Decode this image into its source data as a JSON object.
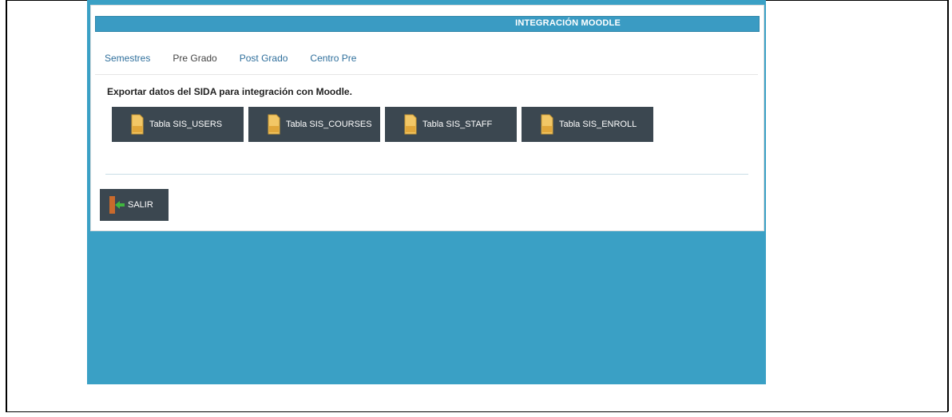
{
  "header": {
    "title": "INTEGRACIÓN MOODLE"
  },
  "tabs": [
    {
      "label": "Semestres"
    },
    {
      "label": "Pre Grado"
    },
    {
      "label": "Post Grado"
    },
    {
      "label": "Centro Pre"
    }
  ],
  "export": {
    "text": "Exportar datos del SIDA para integración con Moodle.",
    "buttons": [
      {
        "label": "Tabla SIS_USERS"
      },
      {
        "label": "Tabla SIS_COURSES"
      },
      {
        "label": "Tabla SIS_STAFF"
      },
      {
        "label": "Tabla SIS_ENROLL"
      }
    ],
    "button_icon": "file-icon"
  },
  "exit": {
    "label": "SALIR",
    "icon": "exit-door-icon"
  },
  "colors": {
    "header": "#3a9bc3",
    "background": "#3aa0c5",
    "button": "#3b4750",
    "tab_link": "#2f6f9c"
  }
}
